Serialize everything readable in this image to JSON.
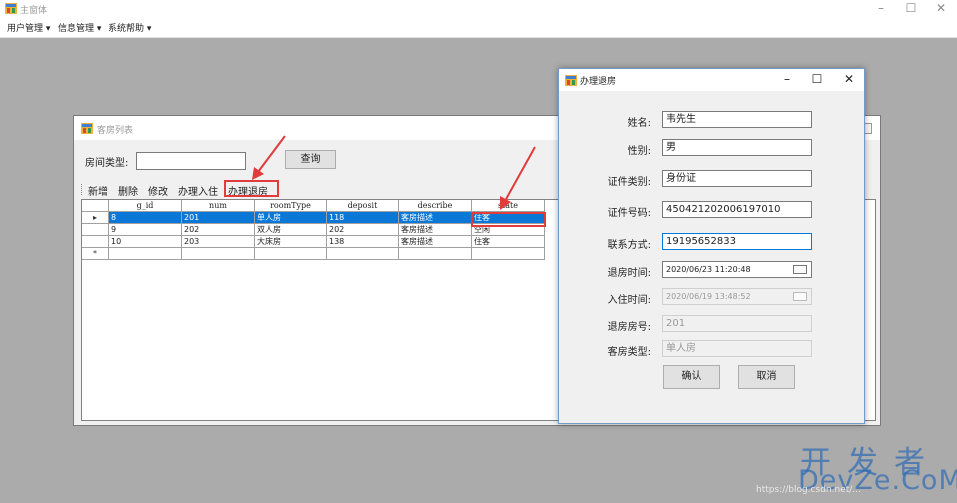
{
  "main_window": {
    "title": "主窗体",
    "controls": {
      "minimize": "–",
      "maximize": "☐",
      "close": "✕"
    }
  },
  "menubar": {
    "items": [
      {
        "label": "用户管理 ▾"
      },
      {
        "label": "信息管理 ▾"
      },
      {
        "label": "系统帮助 ▾"
      }
    ]
  },
  "room_window": {
    "title": "客房列表",
    "room_type_label": "房间类型:",
    "room_type_value": "",
    "query_button": "查询",
    "toolbar": {
      "add": "新增",
      "delete": "删除",
      "edit": "修改",
      "checkin": "办理入住",
      "checkout": "办理退房"
    },
    "grid": {
      "columns": [
        "g_id",
        "num",
        "roomType",
        "deposit",
        "describe",
        "state"
      ],
      "rows": [
        {
          "g_id": "8",
          "num": "201",
          "roomType": "单人房",
          "deposit": "118",
          "describe": "客房描述",
          "state": "住客",
          "selected": true
        },
        {
          "g_id": "9",
          "num": "202",
          "roomType": "双人房",
          "deposit": "202",
          "describe": "客房描述",
          "state": "空闲",
          "selected": false
        },
        {
          "g_id": "10",
          "num": "203",
          "roomType": "大床房",
          "deposit": "138",
          "describe": "客房描述",
          "state": "住客",
          "selected": false
        }
      ],
      "current_row_marker": "▸",
      "new_row_marker": "*"
    }
  },
  "checkout_dialog": {
    "title": "办理退房",
    "controls": {
      "minimize": "–",
      "maximize": "☐",
      "close": "✕"
    },
    "fields": {
      "name": {
        "label": "姓名:",
        "value": "韦先生"
      },
      "gender": {
        "label": "性别:",
        "value": "男"
      },
      "id_type": {
        "label": "证件类别:",
        "value": "身份证"
      },
      "id_number": {
        "label": "证件号码:",
        "value": "450421202006197010"
      },
      "phone": {
        "label": "联系方式:",
        "value": "19195652833"
      },
      "checkout_time": {
        "label": "退房时间:",
        "value": "2020/06/23 11:20:48"
      },
      "checkin_time": {
        "label": "入住时间:",
        "value": "2020/06/19 13:48:52"
      },
      "room_number": {
        "label": "退房房号:",
        "value": "201"
      },
      "room_type": {
        "label": "客房类型:",
        "value": "单人房"
      }
    },
    "ok_button": "确认",
    "cancel_button": "取消"
  },
  "watermark": {
    "cn": "开发者",
    "en": "DevZe.CoM",
    "url": "https://blog.csdn.net/..."
  },
  "colors": {
    "selection": "#0b78d7",
    "highlight": "#e23b3b",
    "mdi_background": "#ababab"
  }
}
